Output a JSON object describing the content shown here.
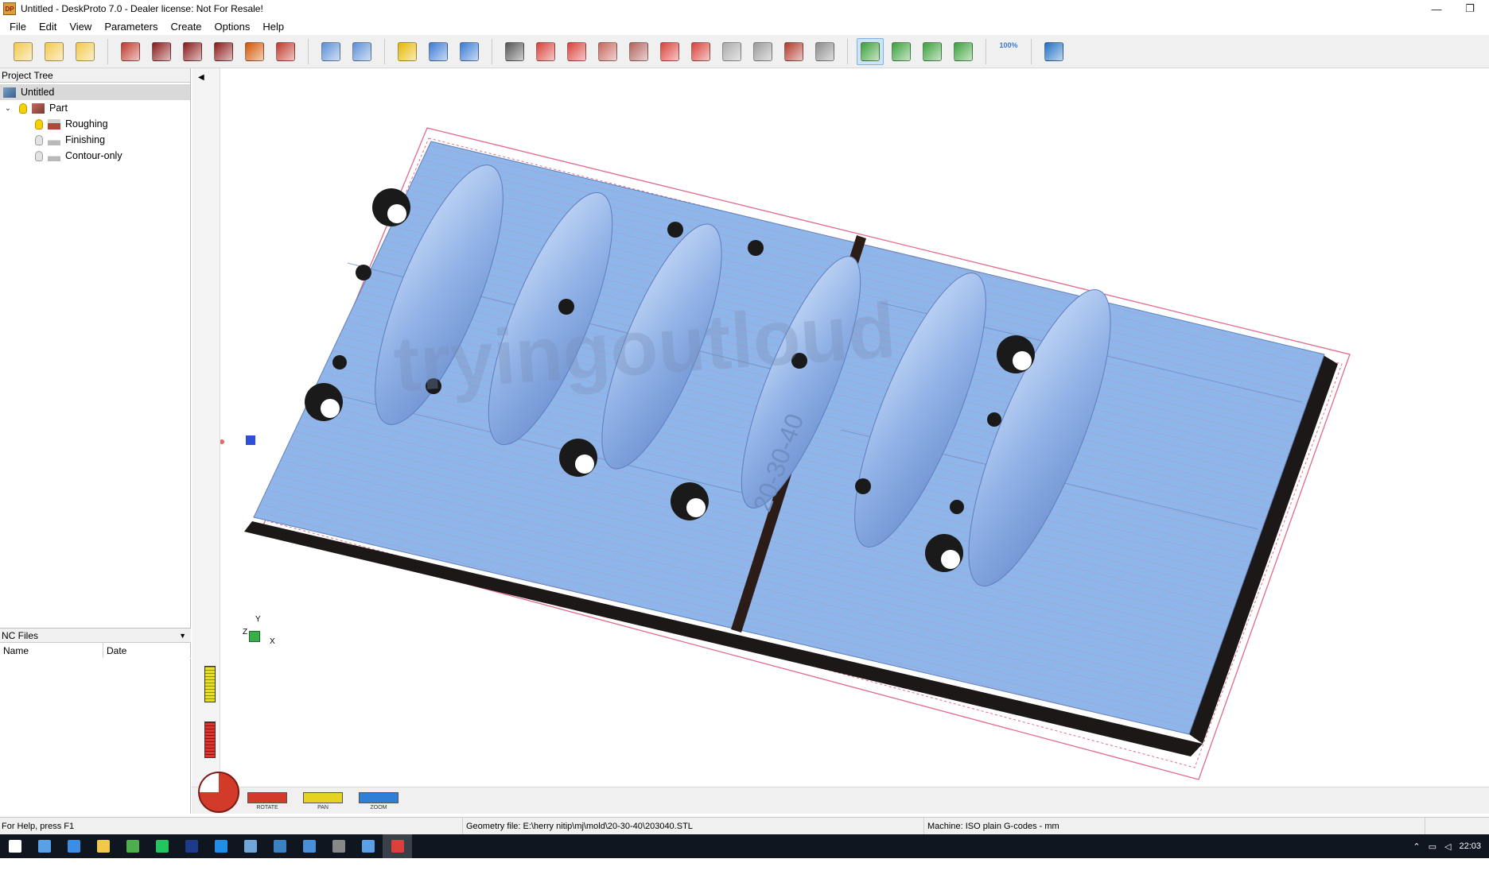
{
  "window": {
    "app_icon_text": "DP",
    "title": "Untitled - DeskProto 7.0 - Dealer license: Not For Resale!",
    "minimize_glyph": "—",
    "restore_glyph": "❐"
  },
  "menu": [
    "File",
    "Edit",
    "View",
    "Parameters",
    "Create",
    "Options",
    "Help"
  ],
  "toolbar": {
    "groups": [
      [
        {
          "icon": "new-project-icon",
          "color": "#f2c84b"
        },
        {
          "icon": "open-folder-icon",
          "color": "#f2c84b"
        },
        {
          "icon": "save-icon",
          "color": "#f2c84b"
        }
      ],
      [
        {
          "icon": "load-geometry-icon",
          "color": "#c0392b"
        },
        {
          "icon": "part-parameters-icon",
          "color": "#8b1a1a"
        },
        {
          "icon": "operation-parameters-icon",
          "color": "#8b1a1a"
        },
        {
          "icon": "cutter-icon",
          "color": "#8b1a1a"
        },
        {
          "icon": "deskproto-d-icon",
          "color": "#d35400"
        },
        {
          "icon": "export-nc-icon",
          "color": "#c0392b"
        }
      ],
      [
        {
          "icon": "simulate-icon",
          "color": "#5b8fd6"
        },
        {
          "icon": "inspect-icon",
          "color": "#5b8fd6"
        }
      ],
      [
        {
          "icon": "info-icon",
          "color": "#e5b800"
        },
        {
          "icon": "layout-grid-icon",
          "color": "#3a7bd5"
        },
        {
          "icon": "layout-view-icon",
          "color": "#3a7bd5"
        }
      ],
      [
        {
          "icon": "camera-icon",
          "color": "#555555"
        },
        {
          "icon": "view-cube-red-icon",
          "color": "#d9413a"
        },
        {
          "icon": "view-front-icon",
          "color": "#d9413a"
        },
        {
          "icon": "view-side-icon",
          "color": "#c7655c"
        },
        {
          "icon": "view-back-icon",
          "color": "#b2635c"
        },
        {
          "icon": "view-top-icon",
          "color": "#d9413a"
        },
        {
          "icon": "view-bottom-icon",
          "color": "#d9413a"
        },
        {
          "icon": "view-iso-grey-icon",
          "color": "#a9a9a9"
        },
        {
          "icon": "view-flat-grey-icon",
          "color": "#9b9b9b"
        },
        {
          "icon": "render-camera-icon",
          "color": "#b0392b"
        },
        {
          "icon": "render-camera-grey-icon",
          "color": "#8c8c8c"
        }
      ],
      [
        {
          "icon": "rotate-view-icon",
          "color": "#3aa13a",
          "active": true
        },
        {
          "icon": "pan-view-icon",
          "color": "#3aa13a"
        },
        {
          "icon": "zoom-in-icon",
          "color": "#3aa13a"
        },
        {
          "icon": "zoom-window-icon",
          "color": "#3aa13a"
        }
      ],
      [
        {
          "icon": "zoom-100-icon",
          "color": "#3a7bd5",
          "label": "100%"
        }
      ],
      [
        {
          "icon": "help-book-icon",
          "color": "#1f6fc2"
        }
      ]
    ]
  },
  "project_tree": {
    "header": "Project Tree",
    "root": "Untitled",
    "part": "Part",
    "operations": [
      "Roughing",
      "Finishing",
      "Contour-only"
    ]
  },
  "nc_files": {
    "header": "NC Files",
    "columns": [
      "Name",
      "Date"
    ]
  },
  "viewbar": {
    "buttons": [
      "ROTATE",
      "PAN",
      "ZOOM"
    ],
    "colors": [
      "#d23a2a",
      "#e5d323",
      "#2f7fd6"
    ]
  },
  "axes": {
    "x": "X",
    "y": "Y",
    "z": "Z"
  },
  "viewport": {
    "watermark": "tryingoutloud",
    "engraving": "20-30-40",
    "model_color": "#8fb6ea",
    "toolpath_color": "#e06a8a"
  },
  "status": {
    "help": "For Help, press F1",
    "geometry": "Geometry file: E:\\herry nitip\\mj\\mold\\20-30-40\\203040.STL",
    "machine": "Machine: ISO plain G-codes - mm"
  },
  "taskbar": {
    "items": [
      "start-icon",
      "search-icon",
      "task-view-icon",
      "edge-icon",
      "store-icon",
      "mail-icon",
      "explorer-icon",
      "chrome-icon",
      "evernote-icon",
      "photoshop-icon",
      "sketchup-icon",
      "photos-icon",
      "gallery-icon",
      "deskproto-icon"
    ],
    "active_index": 13,
    "time": "22:03"
  }
}
